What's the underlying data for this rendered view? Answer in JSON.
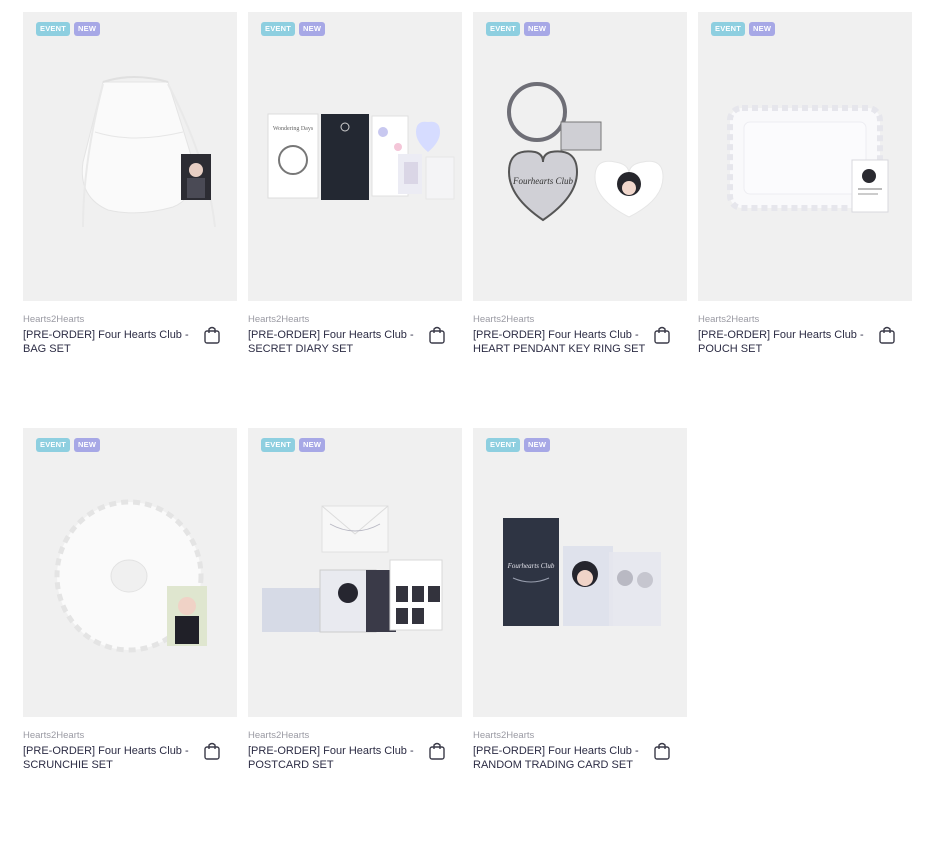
{
  "badges": {
    "event": "EVENT",
    "new": "NEW"
  },
  "products": [
    {
      "brand": "Hearts2Hearts",
      "title": "[PRE-ORDER] Four Hearts Club - BAG SET"
    },
    {
      "brand": "Hearts2Hearts",
      "title": "[PRE-ORDER] Four Hearts Club - SECRET DIARY SET"
    },
    {
      "brand": "Hearts2Hearts",
      "title": "[PRE-ORDER] Four Hearts Club - HEART PENDANT KEY RING SET"
    },
    {
      "brand": "Hearts2Hearts",
      "title": "[PRE-ORDER] Four Hearts Club - POUCH SET"
    },
    {
      "brand": "Hearts2Hearts",
      "title": "[PRE-ORDER] Four Hearts Club - SCRUNCHIE SET"
    },
    {
      "brand": "Hearts2Hearts",
      "title": "[PRE-ORDER] Four Hearts Club - POSTCARD SET"
    },
    {
      "brand": "Hearts2Hearts",
      "title": "[PRE-ORDER] Four Hearts Club - RANDOM TRADING CARD SET"
    }
  ],
  "product_images": {
    "diary_cover_script": "Wondering Days",
    "keyring_script": "Fourhearts Club",
    "trading_card_script": "Fourhearts Club"
  },
  "icons": {
    "cart": "shopping-bag-icon"
  }
}
